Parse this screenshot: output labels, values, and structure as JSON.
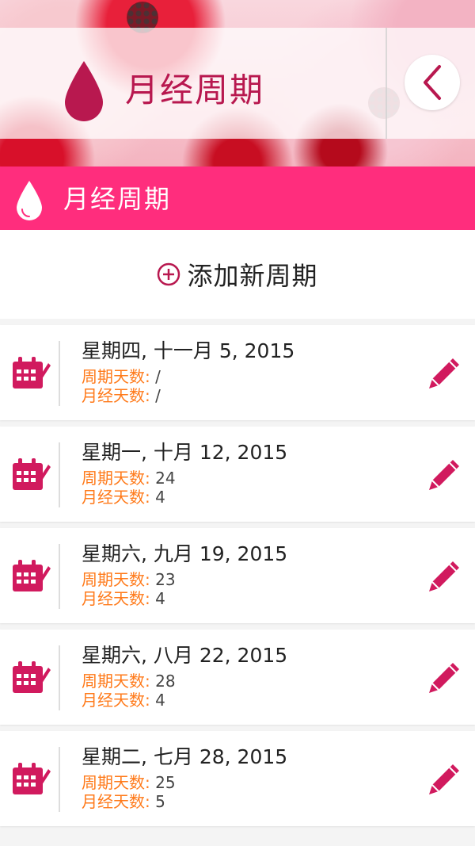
{
  "header": {
    "title": "月经周期"
  },
  "section": {
    "title": "月经周期"
  },
  "add": {
    "label": "添加新周期"
  },
  "colors": {
    "accent": "#ff2d7d",
    "title": "#b8184f",
    "label_orange": "#ff7a1a"
  },
  "cycles": [
    {
      "date": "星期四, 十一月 5, 2015",
      "cycle_label": "周期天数: ",
      "cycle_days": "/",
      "period_label": "月经天数: ",
      "period_days": "/"
    },
    {
      "date": "星期一, 十月 12, 2015",
      "cycle_label": "周期天数: ",
      "cycle_days": "24",
      "period_label": "月经天数: ",
      "period_days": "4"
    },
    {
      "date": "星期六, 九月 19, 2015",
      "cycle_label": "周期天数: ",
      "cycle_days": "23",
      "period_label": "月经天数: ",
      "period_days": "4"
    },
    {
      "date": "星期六, 八月 22, 2015",
      "cycle_label": "周期天数: ",
      "cycle_days": "28",
      "period_label": "月经天数: ",
      "period_days": "4"
    },
    {
      "date": "星期二, 七月 28, 2015",
      "cycle_label": "周期天数: ",
      "cycle_days": "25",
      "period_label": "月经天数: ",
      "period_days": "5"
    }
  ]
}
